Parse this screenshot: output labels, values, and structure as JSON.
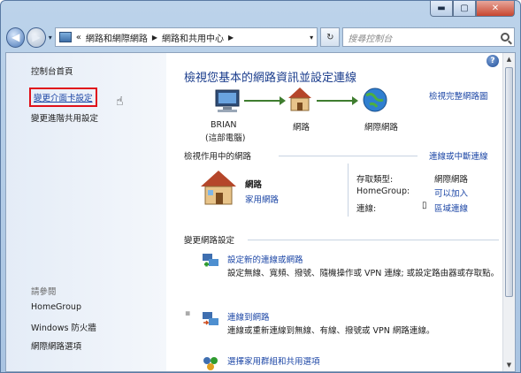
{
  "window": {
    "caption": {
      "minimize": "▬",
      "maximize": "▢",
      "close": "✕"
    }
  },
  "nav": {
    "back": "◀",
    "forward": "▶",
    "dropdown": "▾",
    "breadcrumb_prefix": "«",
    "breadcrumbs": [
      "網路和網際網路",
      "網路和共用中心"
    ],
    "crumb_arrow": "▶",
    "refresh": "↻",
    "search_placeholder": "搜尋控制台"
  },
  "sidebar": {
    "home": "控制台首頁",
    "links": [
      "變更介面卡設定",
      "變更進階共用設定"
    ],
    "see_also_title": "請參閱",
    "see_also": [
      "HomeGroup",
      "Windows 防火牆",
      "網際網路選項"
    ]
  },
  "main": {
    "help": "?",
    "title": "檢視您基本的網路資訊並設定連線",
    "view_full_map": "檢視完整網路圖",
    "map": {
      "computer_name": "BRIAN",
      "computer_sub": "(這部電腦)",
      "network": "網路",
      "internet": "網際網路"
    },
    "active_header": "檢視作用中的網路",
    "connect_disconnect": "連線或中斷連線",
    "network_name": "網路",
    "network_type": "家用網路",
    "access_type_label": "存取類型:",
    "access_type_value": "網際網路",
    "homegroup_label": "HomeGroup:",
    "homegroup_value": "可以加入",
    "connections_label": "連線:",
    "connections_value": "區域連線",
    "change_header": "變更網路設定",
    "tasks": [
      {
        "title": "設定新的連線或網路",
        "desc": "設定無線、寬頻、撥號、隨機操作或 VPN 連線; 或設定路由器或存取點。"
      },
      {
        "title": "連線到網路",
        "desc": "連線或重新連線到無線、有線、撥號或 VPN 網路連線。"
      },
      {
        "title": "選擇家用群組和共用選項",
        "desc": ""
      }
    ]
  }
}
